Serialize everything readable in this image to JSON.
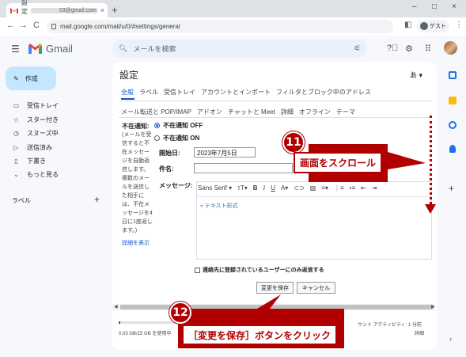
{
  "browser": {
    "tab_title": "設定 - ",
    "tab_email_suffix": "03@gmail.com",
    "tab_close": "×",
    "new_tab": "+",
    "url": "mail.google.com/mail/u/0/#settings/general",
    "guest_label": "ゲスト",
    "win_min": "–",
    "win_max": "□",
    "win_close": "×",
    "back": "←",
    "forward": "→",
    "reload": "C",
    "menu": "⋮"
  },
  "gmail": {
    "logo_text": "Gmail",
    "search_placeholder": "メールを検索",
    "compose_label": "作成",
    "nav": [
      {
        "label": "受信トレイ",
        "icon": "▭"
      },
      {
        "label": "スター付き",
        "icon": "☆"
      },
      {
        "label": "スヌーズ中",
        "icon": "◷"
      },
      {
        "label": "送信済み",
        "icon": "▷"
      },
      {
        "label": "下書き",
        "icon": "▯"
      },
      {
        "label": "もっと見る",
        "icon": "⌄"
      }
    ],
    "labels_heading": "ラベル",
    "labels_add": "+"
  },
  "settings": {
    "title": "設定",
    "ime": "あ ▾",
    "tabs_row1": [
      "全般",
      "ラベル",
      "受信トレイ",
      "アカウントとインポート",
      "フィルタとブロック中のアドレス"
    ],
    "tabs_row2": [
      "メール転送と POP/IMAP",
      "アドオン",
      "チャットと Meet",
      "詳細",
      "オフライン",
      "テーマ"
    ],
    "vacation_label": "不在通知:",
    "vacation_desc": "(メールを受信すると不在メッセージを自動返信します。複数のメールを送信した相手には、不在メッセージを4日に1度返します。)",
    "vacation_link": "詳細を表示",
    "radio_off": "不在通知 OFF",
    "radio_on": "不在通知 ON",
    "start_label": "開始日:",
    "start_value": "2023年7月5日",
    "subject_label": "件名:",
    "message_label": "メッセージ:",
    "font_name": "Sans Serif ▾",
    "plain_text_link": "« テキスト形式",
    "contacts_only": "連絡先に登録されているユーザーにのみ返信する",
    "save_button": "変更を保存",
    "cancel_button": "キャンセル",
    "storage": "0.03 GB/15 GB を使用中",
    "activity": "ウント アクティビティ: 1 分前",
    "details": "詳細"
  },
  "annotations": {
    "step1_number": "11",
    "step1_text": "画面をスクロール",
    "step2_number": "12",
    "step2_text": "［変更を保存］ボタンをクリック"
  },
  "colors": {
    "annotation_red": "#b00000",
    "accent_blue": "#0b57d0",
    "compose_bg": "#c2e7ff"
  }
}
